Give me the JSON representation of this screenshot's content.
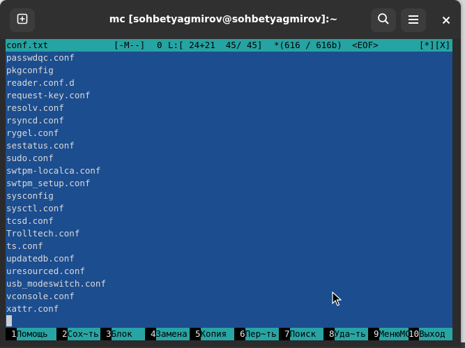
{
  "window": {
    "title": "mc [sohbetyagmirov@sohbetyagmirov]:~"
  },
  "editor": {
    "filename": "conf.txt",
    "mode": "[-M--]",
    "col": "0",
    "line_info": "L:[ 24+21  45/ 45]",
    "pos": "*(616 / 616b)",
    "eof": "<EOF>",
    "flags": "[*][X]"
  },
  "lines": [
    "passwdqc.conf",
    "pkgconfig",
    "reader.conf.d",
    "request-key.conf",
    "resolv.conf",
    "rsyncd.conf",
    "rygel.conf",
    "sestatus.conf",
    "sudo.conf",
    "swtpm-localca.conf",
    "swtpm_setup.conf",
    "sysconfig",
    "sysctl.conf",
    "tcsd.conf",
    "Trolltech.conf",
    "ts.conf",
    "updatedb.conf",
    "uresourced.conf",
    "usb_modeswitch.conf",
    "vconsole.conf",
    "xattr.conf"
  ],
  "fkeys": [
    {
      "num": "1",
      "label": "Помощь"
    },
    {
      "num": "2",
      "label": "Сох~ть"
    },
    {
      "num": "3",
      "label": "Блок"
    },
    {
      "num": "4",
      "label": "Замена"
    },
    {
      "num": "5",
      "label": "Копия"
    },
    {
      "num": "6",
      "label": "Пер~ть"
    },
    {
      "num": "7",
      "label": "Поиск"
    },
    {
      "num": "8",
      "label": "Уда~ть"
    },
    {
      "num": "9",
      "label": "МенюMC"
    },
    {
      "num": "10",
      "label": "Выход"
    }
  ],
  "icons": {
    "new_tab": "new-tab-icon",
    "search": "search-icon",
    "menu": "hamburger-menu-icon",
    "close": "close-icon",
    "pointer": "mouse-pointer-icon"
  },
  "colors": {
    "terminal_bg": "#1c4d8e",
    "statusbar_bg": "#26a3a3",
    "fkey_label_bg": "#27a5a5",
    "text": "#d9d9d9"
  }
}
